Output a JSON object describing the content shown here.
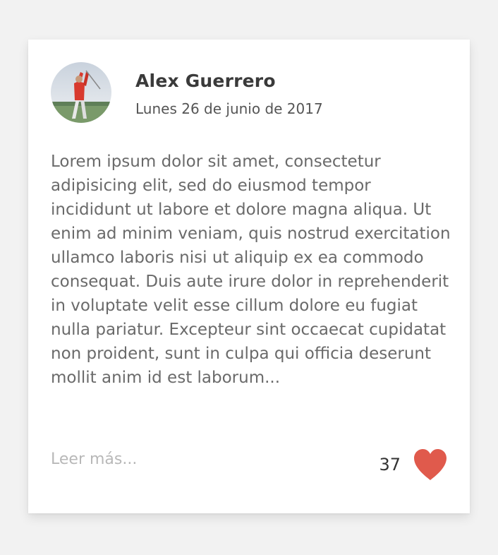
{
  "post": {
    "author": "Alex Guerrero",
    "date": "Lunes 26 de junio de 2017",
    "body": "Lorem ipsum dolor sit amet, consectetur adipisicing elit, sed do eiusmod tempor incididunt ut labore et dolore magna aliqua. Ut enim ad minim veniam, quis nostrud exercitation ullamco laboris nisi ut aliquip ex ea commodo consequat. Duis aute irure dolor in reprehenderit in voluptate velit esse cillum dolore eu fugiat nulla pariatur. Excepteur sint occaecat cupidatat non proident, sunt in culpa qui officia deserunt mollit anim id est laborum...",
    "read_more": "Leer más...",
    "likes": "37"
  },
  "icons": {
    "like": "heart-icon"
  },
  "colors": {
    "heart": "#e05a4c",
    "background": "#f2f2f2",
    "card": "#ffffff"
  }
}
